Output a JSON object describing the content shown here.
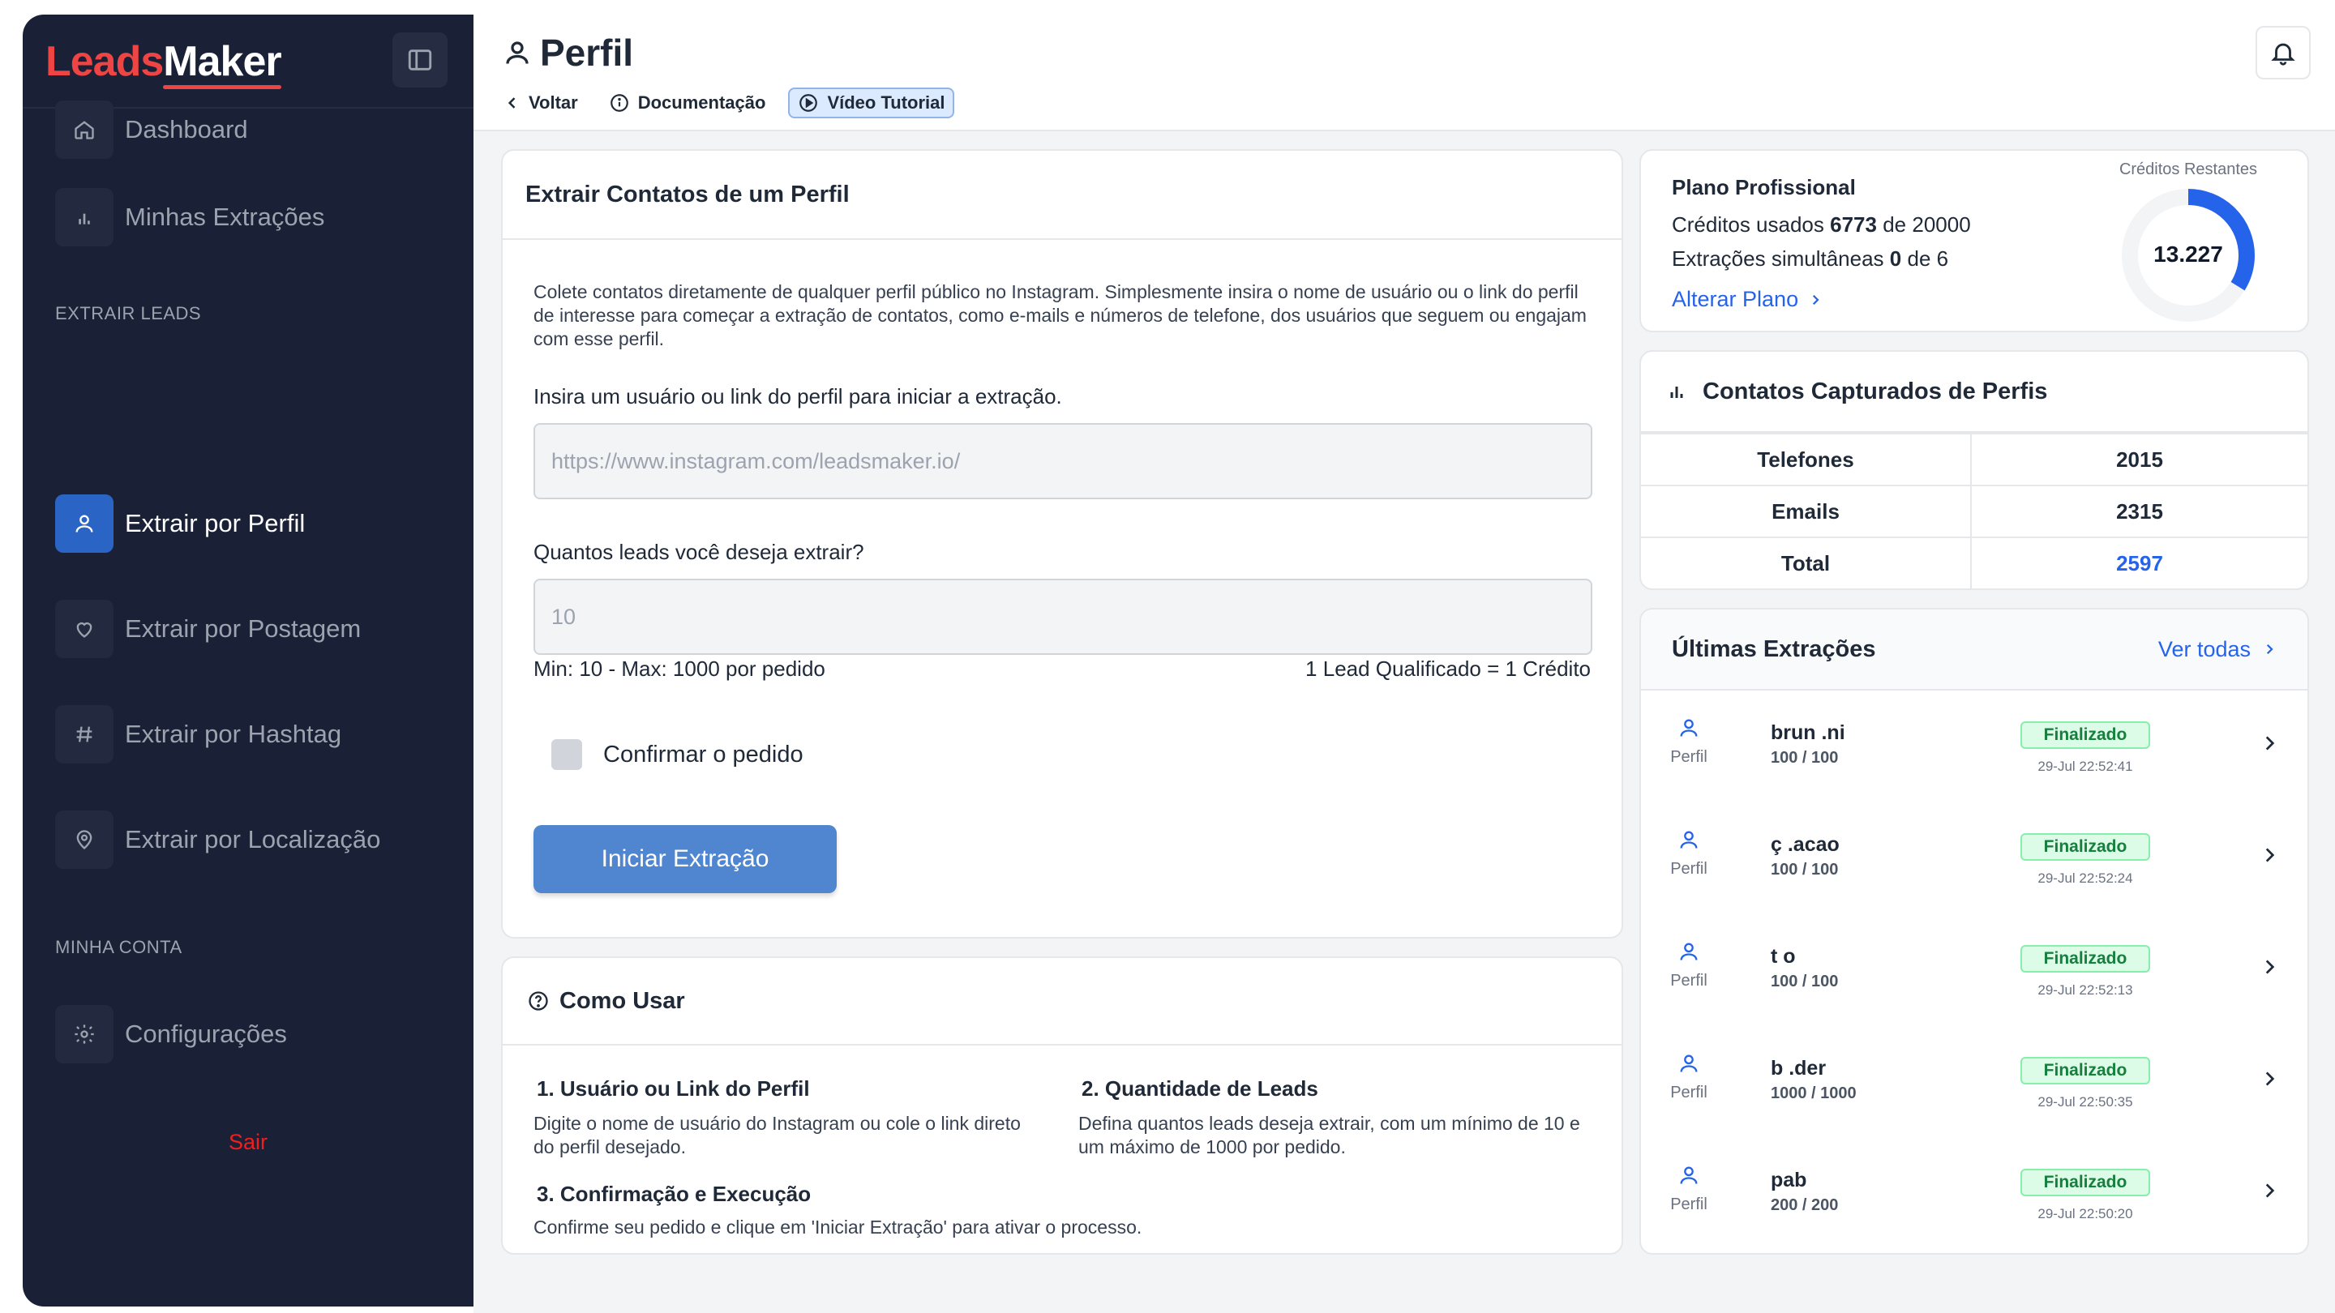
{
  "brand": {
    "leads": "Leads",
    "maker": "Maker",
    "accent": "#ef4444"
  },
  "sidebar": {
    "items": [
      {
        "label": "Dashboard",
        "icon": "home-icon"
      },
      {
        "label": "Minhas Extrações",
        "icon": "bar-chart-icon"
      }
    ],
    "section_extract": "EXTRAIR LEADS",
    "extract_items": [
      {
        "label": "Extrair por Perfil",
        "icon": "user-icon",
        "active": true
      },
      {
        "label": "Extrair por Postagem",
        "icon": "heart-icon"
      },
      {
        "label": "Extrair por Hashtag",
        "icon": "hash-icon"
      },
      {
        "label": "Extrair por Localização",
        "icon": "map-pin-icon"
      }
    ],
    "section_account": "MINHA CONTA",
    "account_items": [
      {
        "label": "Configurações",
        "icon": "gear-icon"
      }
    ],
    "logout": "Sair"
  },
  "header": {
    "title": "Perfil",
    "back": "Voltar",
    "docs": "Documentação",
    "video": "Vídeo Tutorial"
  },
  "extract": {
    "title": "Extrair Contatos de um Perfil",
    "description": "Colete contatos diretamente de qualquer perfil público no Instagram. Simplesmente insira o nome de usuário ou o link do perfil de interesse para começar a extração de contatos, como e-mails e números de telefone, dos usuários que seguem ou engajam com esse perfil.",
    "profile_label": "Insira um usuário ou link do perfil para iniciar a extração.",
    "profile_placeholder": "https://www.instagram.com/leadsmaker.io/",
    "qty_label": "Quantos leads você deseja extrair?",
    "qty_placeholder": "10",
    "qty_hint": "Min: 10 - Max: 1000 por pedido",
    "credit_hint": "1 Lead Qualificado = 1 Crédito",
    "confirm_label": "Confirmar o pedido",
    "start_button": "Iniciar Extração"
  },
  "howto": {
    "title": "Como Usar",
    "steps": [
      {
        "title": "1. Usuário ou Link do Perfil",
        "desc": "Digite o nome de usuário do Instagram ou cole o link direto do perfil desejado."
      },
      {
        "title": "2. Quantidade de Leads",
        "desc": "Defina quantos leads deseja extrair, com um mínimo de 10 e um máximo de 1000 por pedido."
      },
      {
        "title": "3. Confirmação e Execução",
        "desc": "Confirme seu pedido e clique em 'Iniciar Extração' para ativar o processo."
      }
    ]
  },
  "plan": {
    "name": "Plano Profissional",
    "credits_prefix": "Créditos usados",
    "credits_used": "6773",
    "credits_of": "de",
    "credits_total": "20000",
    "simult_prefix": "Extrações simultâneas",
    "simult_used": "0",
    "simult_of": "de",
    "simult_total": "6",
    "change_plan": "Alterar Plano",
    "remaining_label": "Créditos Restantes",
    "remaining_value": "13.227",
    "used_fraction": 0.33865,
    "ring_color": "#2563eb"
  },
  "contacts": {
    "title": "Contatos Capturados de Perfis",
    "rows": [
      {
        "label": "Telefones",
        "value": "2015"
      },
      {
        "label": "Emails",
        "value": "2315"
      },
      {
        "label": "Total",
        "value": "2597"
      }
    ]
  },
  "latest": {
    "title": "Últimas Extrações",
    "see_all": "Ver todas",
    "type_label": "Perfil",
    "rows": [
      {
        "user": "brun          .ni",
        "count": "100 / 100",
        "status": "Finalizado",
        "date": "29-Jul 22:52:41"
      },
      {
        "user": "ç          .acao",
        "count": "100 / 100",
        "status": "Finalizado",
        "date": "29-Jul 22:52:24"
      },
      {
        "user": "t              o",
        "count": "100 / 100",
        "status": "Finalizado",
        "date": "29-Jul 22:52:13"
      },
      {
        "user": "b          .der",
        "count": "1000 / 1000",
        "status": "Finalizado",
        "date": "29-Jul 22:50:35"
      },
      {
        "user": "pab",
        "count": "200 / 200",
        "status": "Finalizado",
        "date": "29-Jul 22:50:20"
      }
    ]
  }
}
